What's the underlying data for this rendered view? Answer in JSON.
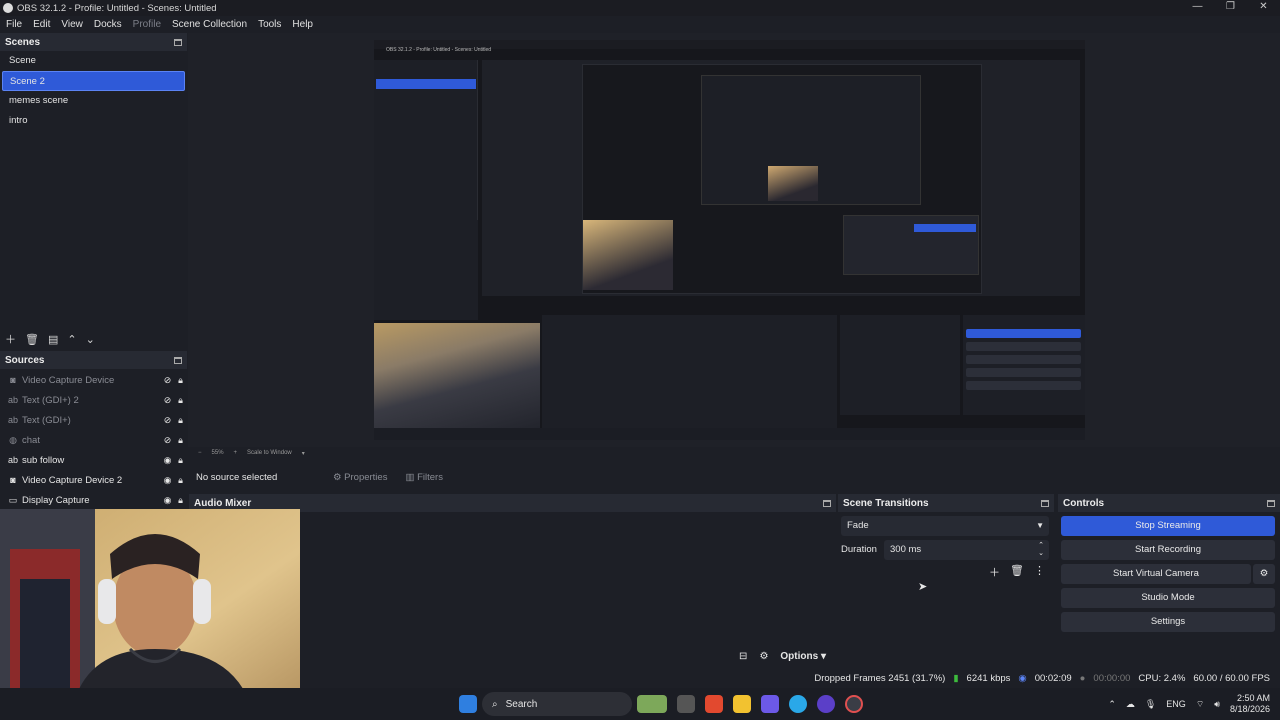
{
  "window": {
    "title": "OBS 32.1.2 - Profile: Untitled - Scenes: Untitled"
  },
  "menu": [
    "File",
    "Edit",
    "View",
    "Docks",
    "Profile",
    "Scene Collection",
    "Tools",
    "Help"
  ],
  "scenes": {
    "title": "Scenes",
    "items": [
      "Scene",
      "Scene 2",
      "memes scene",
      "intro"
    ],
    "selected": "Scene 2"
  },
  "sources": {
    "title": "Sources",
    "items": [
      {
        "label": "Video Capture Device",
        "icon": "camera-icon",
        "visible": false
      },
      {
        "label": "Text (GDI+) 2",
        "icon": "text-icon",
        "visible": false
      },
      {
        "label": "Text (GDI+)",
        "icon": "text-icon",
        "visible": false
      },
      {
        "label": "chat",
        "icon": "browser-icon",
        "visible": false
      },
      {
        "label": "sub follow",
        "icon": "text-icon",
        "visible": true
      },
      {
        "label": "Video Capture Device 2",
        "icon": "camera-icon",
        "visible": true
      },
      {
        "label": "Display Capture",
        "icon": "monitor-icon",
        "visible": true
      }
    ]
  },
  "preview": {
    "zoom": "55%",
    "scale_label": "Scale to Window",
    "nested_title": "OBS 32.1.2 - Profile: Untitled - Scenes: Untitled"
  },
  "props_bar": {
    "no_source": "No source selected",
    "properties": "Properties",
    "filters": "Filters"
  },
  "mixer": {
    "title": "Audio Mixer",
    "options_label": "Options"
  },
  "transitions": {
    "title": "Scene Transitions",
    "transition": "Fade",
    "duration_label": "Duration",
    "duration_value": "300 ms"
  },
  "controls": {
    "title": "Controls",
    "stop_streaming": "Stop Streaming",
    "start_recording": "Start Recording",
    "start_virtual_camera": "Start Virtual Camera",
    "studio_mode": "Studio Mode",
    "settings": "Settings"
  },
  "status": {
    "dropped_frames": "Dropped Frames 2451 (31.7%)",
    "bitrate": "6241 kbps",
    "stream_time": "00:02:09",
    "record_time": "00:00:00",
    "cpu": "CPU: 2.4%",
    "fps": "60.00 / 60.00 FPS"
  },
  "taskbar": {
    "search": "Search",
    "lang": "ENG",
    "time": "2:50 AM",
    "date": "8/18/2026"
  },
  "colors": {
    "accent": "#2f5ad8",
    "bg": "#1d1f26",
    "panel_header": "#272a33"
  }
}
